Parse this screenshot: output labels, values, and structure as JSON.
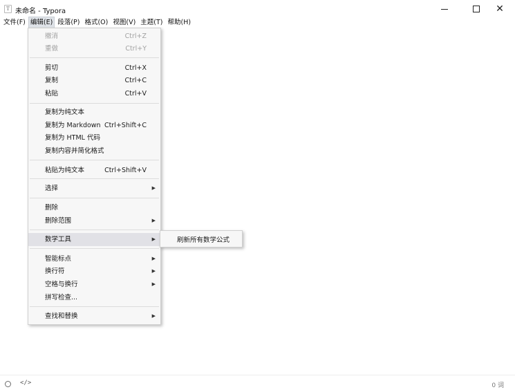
{
  "window": {
    "title": "未命名 - Typora",
    "app_icon_glyph": "T",
    "close_glyph": "✕"
  },
  "menubar": {
    "items": [
      {
        "label": "文件(F)"
      },
      {
        "label": "编辑(E)"
      },
      {
        "label": "段落(P)"
      },
      {
        "label": "格式(O)"
      },
      {
        "label": "视图(V)"
      },
      {
        "label": "主题(T)"
      },
      {
        "label": "帮助(H)"
      }
    ]
  },
  "edit_menu": {
    "items": [
      {
        "label": "撤消",
        "shortcut": "Ctrl+Z",
        "disabled": true
      },
      {
        "label": "重做",
        "shortcut": "Ctrl+Y",
        "disabled": true
      },
      {
        "label": "剪切",
        "shortcut": "Ctrl+X"
      },
      {
        "label": "复制",
        "shortcut": "Ctrl+C"
      },
      {
        "label": "粘贴",
        "shortcut": "Ctrl+V"
      },
      {
        "label": "复制为纯文本",
        "shortcut": ""
      },
      {
        "label": "复制为 Markdown",
        "shortcut": "Ctrl+Shift+C"
      },
      {
        "label": "复制为 HTML 代码",
        "shortcut": ""
      },
      {
        "label": "复制内容并简化格式",
        "shortcut": ""
      },
      {
        "label": "粘贴为纯文本",
        "shortcut": "Ctrl+Shift+V"
      },
      {
        "label": "选择",
        "submenu": true
      },
      {
        "label": "删除",
        "shortcut": ""
      },
      {
        "label": "删除范围",
        "submenu": true
      },
      {
        "label": "数学工具",
        "submenu": true,
        "highlighted": true
      },
      {
        "label": "智能标点",
        "submenu": true
      },
      {
        "label": "换行符",
        "submenu": true
      },
      {
        "label": "空格与换行",
        "submenu": true
      },
      {
        "label": "拼写检查...",
        "shortcut": ""
      },
      {
        "label": "查找和替换",
        "submenu": true
      }
    ],
    "submenu_arrow": "▶"
  },
  "math_submenu": {
    "items": [
      {
        "label": "刷新所有数学公式"
      }
    ]
  },
  "statusbar": {
    "code_toggle": "</>",
    "word_count": "0 词"
  }
}
